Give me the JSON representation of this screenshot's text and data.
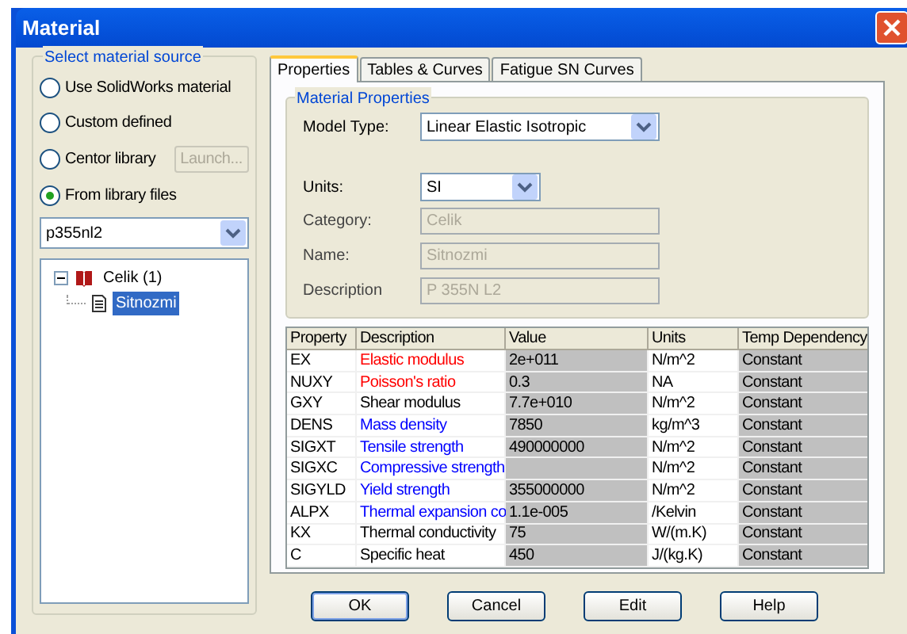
{
  "window": {
    "title": "Material"
  },
  "source": {
    "title": "Select material source",
    "options": [
      {
        "label": "Use SolidWorks material",
        "selected": false
      },
      {
        "label": "Custom defined",
        "selected": false
      },
      {
        "label": "Centor library",
        "selected": false
      },
      {
        "label": "From library files",
        "selected": true
      }
    ],
    "launch_button": {
      "label": "Launch...",
      "disabled": true
    },
    "library": "p355nl2",
    "tree": [
      {
        "label": "Celik (1)",
        "expanded": true,
        "selected": false,
        "children": [
          {
            "label": "Sitnozmi",
            "selected": true
          }
        ]
      }
    ]
  },
  "tabs": [
    {
      "label": "Properties",
      "selected": true
    },
    {
      "label": "Tables & Curves",
      "selected": false
    },
    {
      "label": "Fatigue SN Curves",
      "selected": false
    }
  ],
  "properties": {
    "title": "Material Properties",
    "model_type": {
      "label": "Model Type:",
      "value": "Linear Elastic Isotropic"
    },
    "units": {
      "label": "Units:",
      "value": "SI"
    },
    "fields": [
      {
        "label": "Category:",
        "value": "Celik",
        "disabled": true
      },
      {
        "label": "Name:",
        "value": "Sitnozmi",
        "disabled": true
      },
      {
        "label": "Description",
        "value": "P 355N L2",
        "disabled": true
      }
    ]
  },
  "table": {
    "columns": [
      "Property",
      "Description",
      "Value",
      "Units",
      "Temp Dependency"
    ],
    "rows": [
      {
        "property": "EX",
        "description": "Elastic modulus",
        "color": "#ff0000",
        "value": "2e+011",
        "units": "N/m^2",
        "temp": "Constant"
      },
      {
        "property": "NUXY",
        "description": "Poisson's ratio",
        "color": "#ff0000",
        "value": "0.3",
        "units": "NA",
        "temp": "Constant"
      },
      {
        "property": "GXY",
        "description": "Shear modulus",
        "color": "#000000",
        "value": "7.7e+010",
        "units": "N/m^2",
        "temp": "Constant"
      },
      {
        "property": "DENS",
        "description": "Mass density",
        "color": "#0000ff",
        "value": "7850",
        "units": "kg/m^3",
        "temp": "Constant"
      },
      {
        "property": "SIGXT",
        "description": "Tensile strength",
        "color": "#0000ff",
        "value": "490000000",
        "units": "N/m^2",
        "temp": "Constant"
      },
      {
        "property": "SIGXC",
        "description": "Compressive strength",
        "color": "#0000ff",
        "units": "N/m^2",
        "temp": "Constant"
      },
      {
        "property": "SIGYLD",
        "description": "Yield strength",
        "color": "#0000ff",
        "value": "355000000",
        "units": "N/m^2",
        "temp": "Constant"
      },
      {
        "property": "ALPX",
        "description": "Thermal expansion co",
        "color": "#0000ff",
        "value": "1.1e-005",
        "units": "/Kelvin",
        "temp": "Constant"
      },
      {
        "property": "KX",
        "description": "Thermal conductivity",
        "color": "#000000",
        "value": "75",
        "units": "W/(m.K)",
        "temp": "Constant"
      },
      {
        "property": "C",
        "description": "Specific heat",
        "color": "#000000",
        "value": "450",
        "units": "J/(kg.K)",
        "temp": "Constant"
      }
    ]
  },
  "buttons": [
    {
      "label": "OK",
      "default": true
    },
    {
      "label": "Cancel",
      "default": false
    },
    {
      "label": "Edit",
      "default": false
    },
    {
      "label": "Help",
      "default": false
    }
  ]
}
